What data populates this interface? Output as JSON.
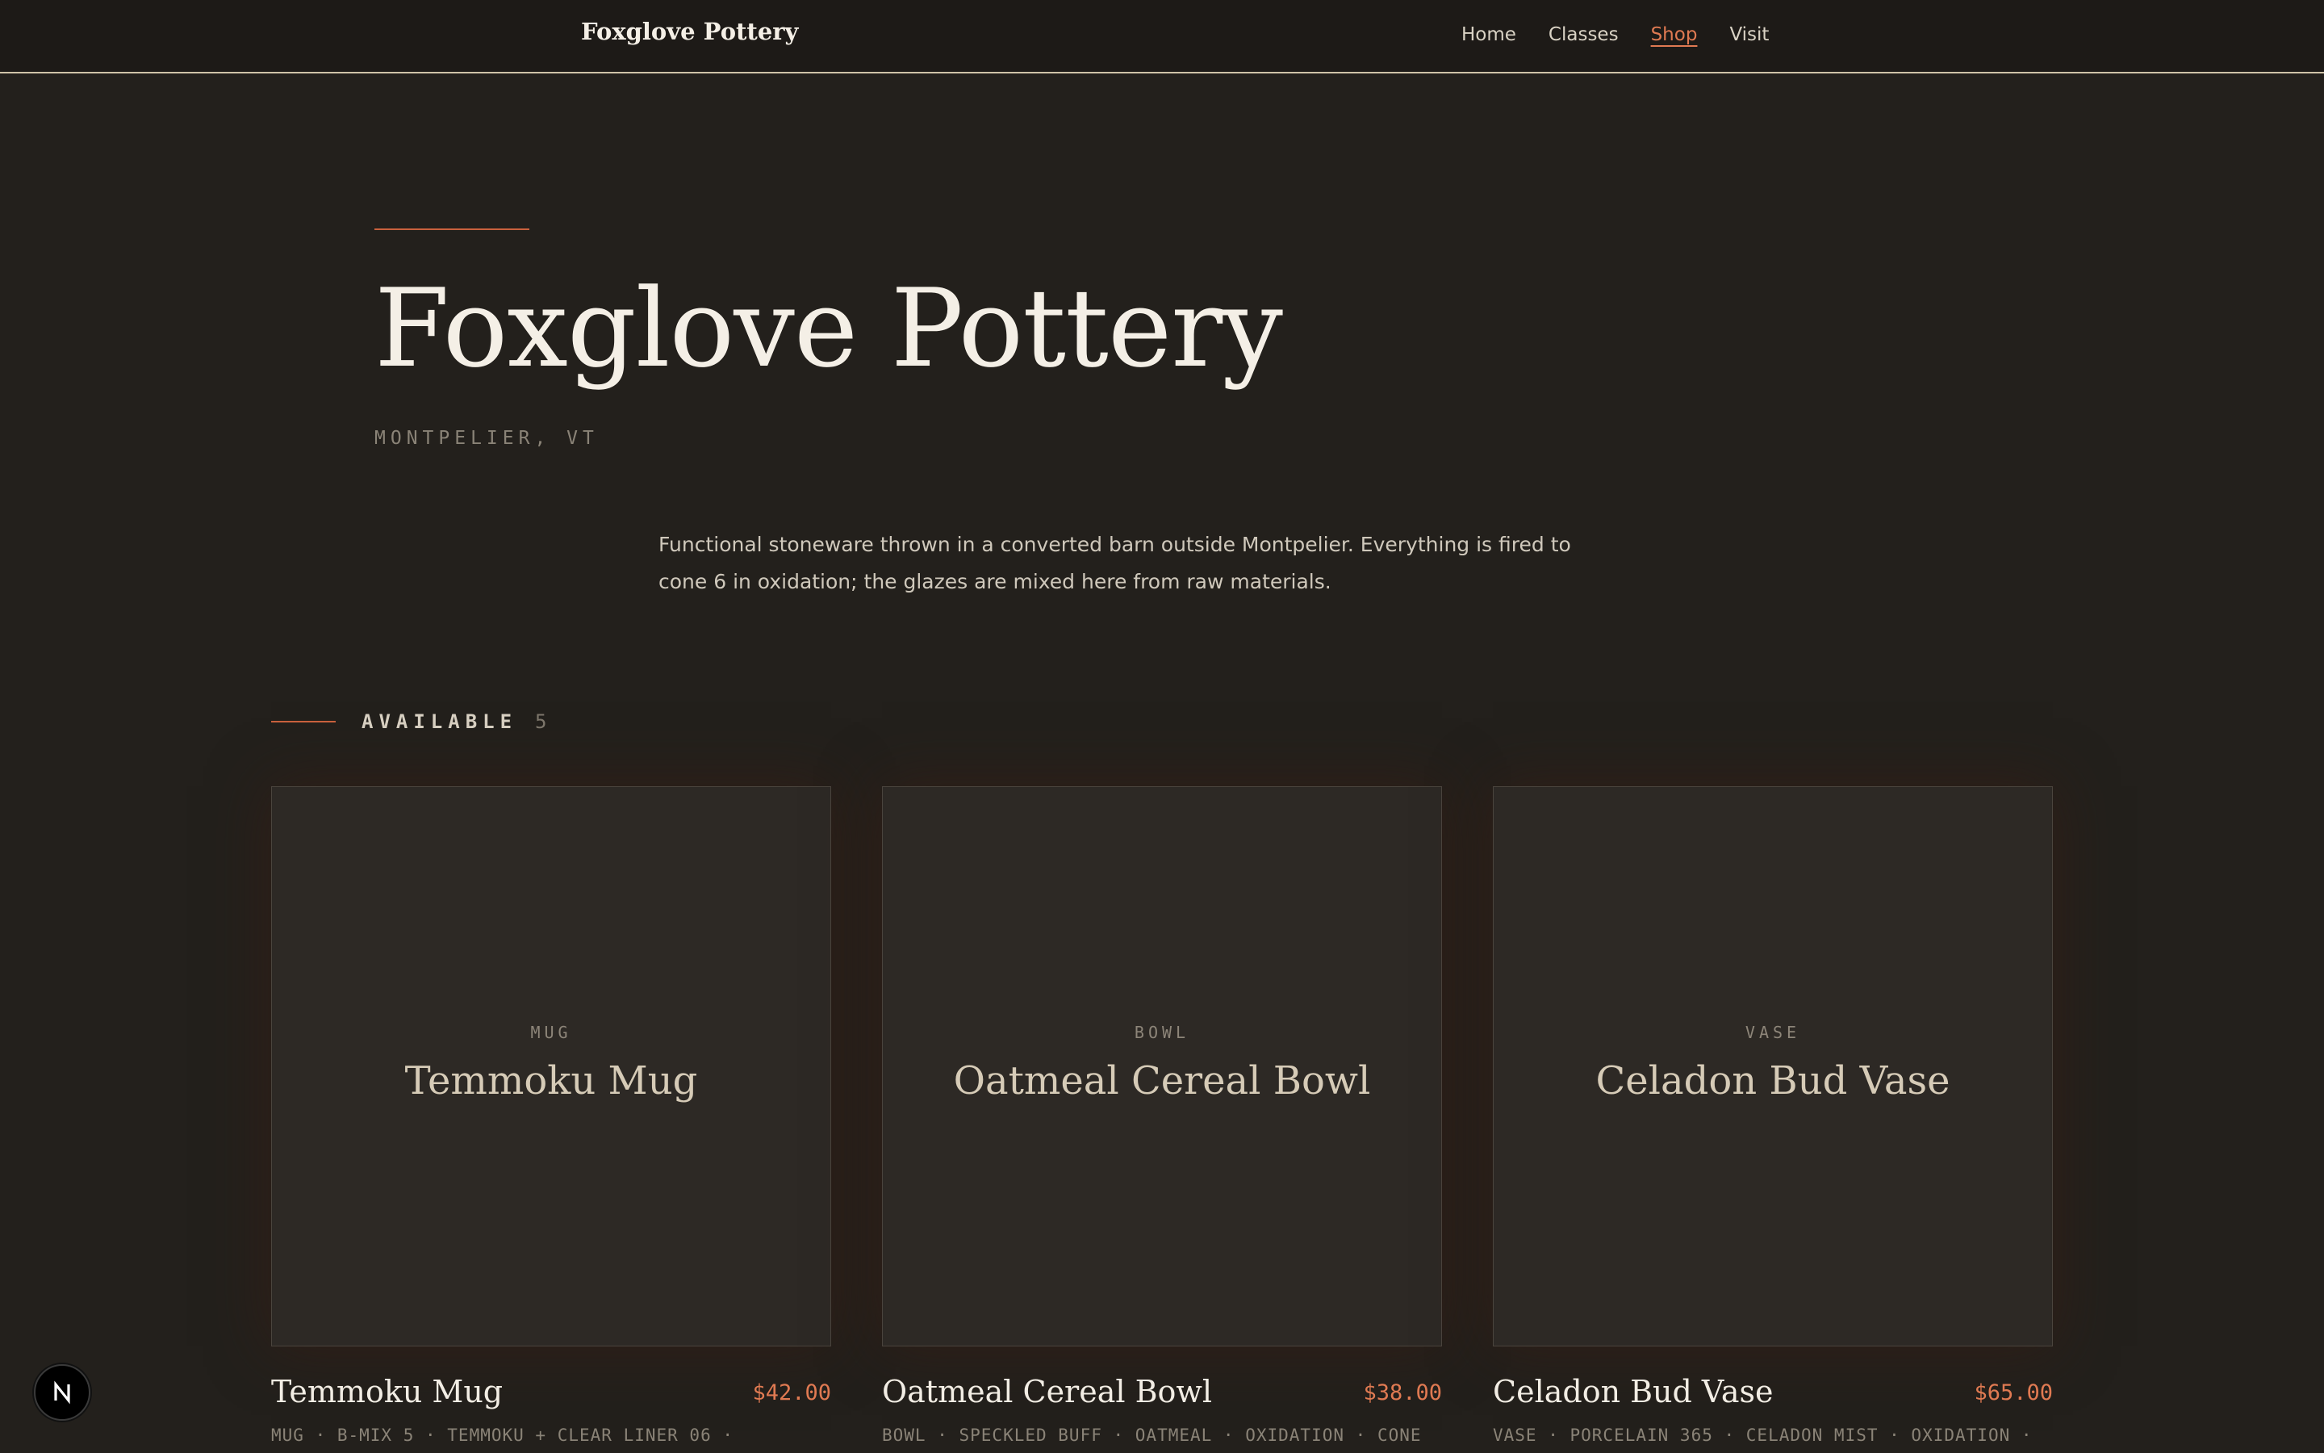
{
  "header": {
    "brand": "Foxglove Pottery",
    "nav": [
      {
        "label": "Home",
        "active": false
      },
      {
        "label": "Classes",
        "active": false
      },
      {
        "label": "Shop",
        "active": true
      },
      {
        "label": "Visit",
        "active": false
      }
    ]
  },
  "hero": {
    "title": "Foxglove Pottery",
    "location": "MONTPELIER, VT",
    "intro": "Functional stoneware thrown in a converted barn outside Montpelier. Everything is fired to cone 6 in oxidation; the glazes are mixed here from raw materials."
  },
  "section": {
    "label": "AVAILABLE",
    "count": "5"
  },
  "products": [
    {
      "kind": "MUG",
      "name": "Temmoku Mug",
      "price": "$42.00",
      "specs": "MUG · B-MIX 5 · TEMMOKU + CLEAR LINER 06 ·"
    },
    {
      "kind": "BOWL",
      "name": "Oatmeal Cereal Bowl",
      "price": "$38.00",
      "specs": "BOWL · SPECKLED BUFF · OATMEAL · OXIDATION · CONE"
    },
    {
      "kind": "VASE",
      "name": "Celadon Bud Vase",
      "price": "$65.00",
      "specs": "VASE · PORCELAIN 365 · CELADON MIST · OXIDATION ·"
    }
  ],
  "badge": {
    "icon": "next-logo-icon"
  },
  "colors": {
    "accent": "#e07a52",
    "background": "#23201c",
    "header_background": "#1d1a17",
    "tile_background": "#2d2925"
  }
}
